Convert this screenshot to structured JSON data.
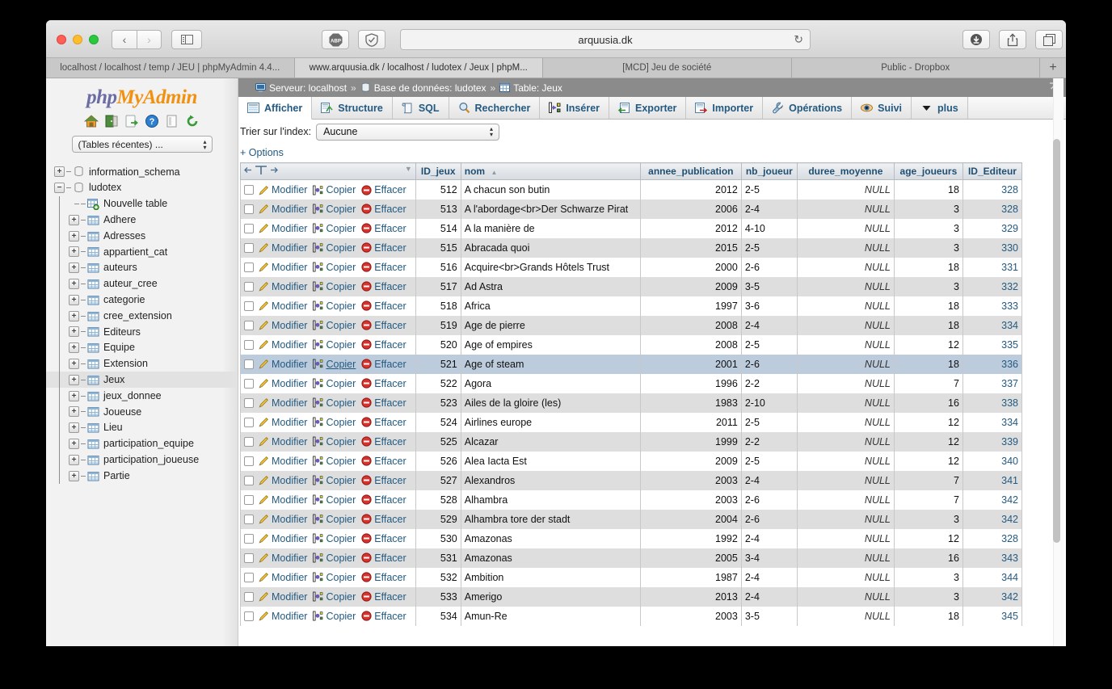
{
  "browser": {
    "url": "arquusia.dk",
    "toolbar": {
      "back_label": "‹",
      "forward_label": "›",
      "sidebar_label": "▤",
      "abp_label": "ABP",
      "shield_label": "✓",
      "reload_label": "↻",
      "download_label": "⬇",
      "share_label": "⬆",
      "tabs_label": "❐"
    },
    "tabs": [
      {
        "title": "localhost / localhost / temp / JEU | phpMyAdmin 4.4...",
        "active": false
      },
      {
        "title": "www.arquusia.dk / localhost / ludotex / Jeux | phpM...",
        "active": true
      },
      {
        "title": "[MCD] Jeu de société",
        "active": false
      },
      {
        "title": "Public - Dropbox",
        "active": false
      }
    ],
    "new_tab_label": "+"
  },
  "pma": {
    "logo": {
      "php": "php",
      "my": "My",
      "admin": "Admin"
    },
    "nav_icons": [
      "home-icon",
      "exit-icon",
      "sql-query-icon",
      "help-icon",
      "docs-icon",
      "reload-nav-icon"
    ],
    "recent_tables_label": "(Tables récentes) ...",
    "tree": [
      {
        "label": "information_schema",
        "level": 1,
        "expander": "+",
        "icon": "database-icon",
        "selected": false
      },
      {
        "label": "ludotex",
        "level": 1,
        "expander": "−",
        "icon": "database-icon",
        "selected": false
      },
      {
        "label": "Nouvelle table",
        "level": 2,
        "expander": "",
        "icon": "new-table-icon",
        "selected": false
      },
      {
        "label": "Adhere",
        "level": 2,
        "expander": "+",
        "icon": "table-icon",
        "selected": false
      },
      {
        "label": "Adresses",
        "level": 2,
        "expander": "+",
        "icon": "table-icon",
        "selected": false
      },
      {
        "label": "appartient_cat",
        "level": 2,
        "expander": "+",
        "icon": "table-icon",
        "selected": false
      },
      {
        "label": "auteurs",
        "level": 2,
        "expander": "+",
        "icon": "table-icon",
        "selected": false
      },
      {
        "label": "auteur_cree",
        "level": 2,
        "expander": "+",
        "icon": "table-icon",
        "selected": false
      },
      {
        "label": "categorie",
        "level": 2,
        "expander": "+",
        "icon": "table-icon",
        "selected": false
      },
      {
        "label": "cree_extension",
        "level": 2,
        "expander": "+",
        "icon": "table-icon",
        "selected": false
      },
      {
        "label": "Editeurs",
        "level": 2,
        "expander": "+",
        "icon": "table-icon",
        "selected": false
      },
      {
        "label": "Equipe",
        "level": 2,
        "expander": "+",
        "icon": "table-icon",
        "selected": false
      },
      {
        "label": "Extension",
        "level": 2,
        "expander": "+",
        "icon": "table-icon",
        "selected": false
      },
      {
        "label": "Jeux",
        "level": 2,
        "expander": "+",
        "icon": "table-icon",
        "selected": true
      },
      {
        "label": "jeux_donnee",
        "level": 2,
        "expander": "+",
        "icon": "table-icon",
        "selected": false
      },
      {
        "label": "Joueuse",
        "level": 2,
        "expander": "+",
        "icon": "table-icon",
        "selected": false
      },
      {
        "label": "Lieu",
        "level": 2,
        "expander": "+",
        "icon": "table-icon",
        "selected": false
      },
      {
        "label": "participation_equipe",
        "level": 2,
        "expander": "+",
        "icon": "table-icon",
        "selected": false
      },
      {
        "label": "participation_joueuse",
        "level": 2,
        "expander": "+",
        "icon": "table-icon",
        "selected": false
      },
      {
        "label": "Partie",
        "level": 2,
        "expander": "+",
        "icon": "table-icon",
        "selected": false
      }
    ],
    "breadcrumb": {
      "server_label": "Serveur: localhost",
      "database_label": "Base de données: ludotex",
      "table_label": "Table: Jeux",
      "separator": "»",
      "collapse_label": "⤒"
    },
    "tabs": [
      {
        "label": "Afficher",
        "icon": "browse-icon",
        "active": true
      },
      {
        "label": "Structure",
        "icon": "structure-icon",
        "active": false
      },
      {
        "label": "SQL",
        "icon": "sql-icon",
        "active": false
      },
      {
        "label": "Rechercher",
        "icon": "search-icon",
        "active": false
      },
      {
        "label": "Insérer",
        "icon": "insert-icon",
        "active": false
      },
      {
        "label": "Exporter",
        "icon": "export-icon",
        "active": false
      },
      {
        "label": "Importer",
        "icon": "import-icon",
        "active": false
      },
      {
        "label": "Opérations",
        "icon": "operations-icon",
        "active": false
      },
      {
        "label": "Suivi",
        "icon": "tracking-icon",
        "active": false
      },
      {
        "label": "plus",
        "icon": "chevron-down-icon",
        "active": false
      }
    ],
    "sort_index": {
      "label": "Trier sur l'index:",
      "value": "Aucune"
    },
    "options_link": "+ Options",
    "row_actions": {
      "edit": "Modifier",
      "copy": "Copier",
      "delete": "Effacer"
    },
    "table": {
      "move_header": "←T→",
      "columns": [
        "ID_jeux",
        "nom",
        "annee_publication",
        "nb_joueur",
        "duree_moyenne",
        "age_joueurs",
        "ID_Editeur"
      ],
      "sorted_column": "nom",
      "sort_direction": "asc",
      "rows": [
        {
          "id": "512",
          "nom": "A chacun son butin",
          "annee": "2012",
          "nb": "2-5",
          "duree": "NULL",
          "age": "18",
          "editeur": "328",
          "highlight": false
        },
        {
          "id": "513",
          "nom": "A l'abordage<br>Der Schwarze Pirat",
          "annee": "2006",
          "nb": "2-4",
          "duree": "NULL",
          "age": "3",
          "editeur": "328",
          "highlight": false
        },
        {
          "id": "514",
          "nom": "A la manière de",
          "annee": "2012",
          "nb": "4-10",
          "duree": "NULL",
          "age": "3",
          "editeur": "329",
          "highlight": false
        },
        {
          "id": "515",
          "nom": "Abracada quoi",
          "annee": "2015",
          "nb": "2-5",
          "duree": "NULL",
          "age": "3",
          "editeur": "330",
          "highlight": false
        },
        {
          "id": "516",
          "nom": "Acquire<br>Grands Hôtels Trust",
          "annee": "2000",
          "nb": "2-6",
          "duree": "NULL",
          "age": "18",
          "editeur": "331",
          "highlight": false
        },
        {
          "id": "517",
          "nom": "Ad Astra",
          "annee": "2009",
          "nb": "3-5",
          "duree": "NULL",
          "age": "3",
          "editeur": "332",
          "highlight": false
        },
        {
          "id": "518",
          "nom": "Africa",
          "annee": "1997",
          "nb": "3-6",
          "duree": "NULL",
          "age": "18",
          "editeur": "333",
          "highlight": false
        },
        {
          "id": "519",
          "nom": "Age de pierre",
          "annee": "2008",
          "nb": "2-4",
          "duree": "NULL",
          "age": "18",
          "editeur": "334",
          "highlight": false
        },
        {
          "id": "520",
          "nom": "Age of empires",
          "annee": "2008",
          "nb": "2-5",
          "duree": "NULL",
          "age": "12",
          "editeur": "335",
          "highlight": false
        },
        {
          "id": "521",
          "nom": "Age of steam",
          "annee": "2001",
          "nb": "2-6",
          "duree": "NULL",
          "age": "18",
          "editeur": "336",
          "highlight": true
        },
        {
          "id": "522",
          "nom": "Agora",
          "annee": "1996",
          "nb": "2-2",
          "duree": "NULL",
          "age": "7",
          "editeur": "337",
          "highlight": false
        },
        {
          "id": "523",
          "nom": "Ailes de la gloire (les)",
          "annee": "1983",
          "nb": "2-10",
          "duree": "NULL",
          "age": "16",
          "editeur": "338",
          "highlight": false
        },
        {
          "id": "524",
          "nom": "Airlines europe",
          "annee": "2011",
          "nb": "2-5",
          "duree": "NULL",
          "age": "12",
          "editeur": "334",
          "highlight": false
        },
        {
          "id": "525",
          "nom": "Alcazar",
          "annee": "1999",
          "nb": "2-2",
          "duree": "NULL",
          "age": "12",
          "editeur": "339",
          "highlight": false
        },
        {
          "id": "526",
          "nom": "Alea Iacta Est",
          "annee": "2009",
          "nb": "2-5",
          "duree": "NULL",
          "age": "12",
          "editeur": "340",
          "highlight": false
        },
        {
          "id": "527",
          "nom": "Alexandros",
          "annee": "2003",
          "nb": "2-4",
          "duree": "NULL",
          "age": "7",
          "editeur": "341",
          "highlight": false
        },
        {
          "id": "528",
          "nom": "Alhambra",
          "annee": "2003",
          "nb": "2-6",
          "duree": "NULL",
          "age": "7",
          "editeur": "342",
          "highlight": false
        },
        {
          "id": "529",
          "nom": "Alhambra tore der stadt",
          "annee": "2004",
          "nb": "2-6",
          "duree": "NULL",
          "age": "3",
          "editeur": "342",
          "highlight": false
        },
        {
          "id": "530",
          "nom": "Amazonas",
          "annee": "1992",
          "nb": "2-4",
          "duree": "NULL",
          "age": "12",
          "editeur": "328",
          "highlight": false
        },
        {
          "id": "531",
          "nom": "Amazonas",
          "annee": "2005",
          "nb": "3-4",
          "duree": "NULL",
          "age": "16",
          "editeur": "343",
          "highlight": false
        },
        {
          "id": "532",
          "nom": "Ambition",
          "annee": "1987",
          "nb": "2-4",
          "duree": "NULL",
          "age": "3",
          "editeur": "344",
          "highlight": false
        },
        {
          "id": "533",
          "nom": "Amerigo",
          "annee": "2013",
          "nb": "2-4",
          "duree": "NULL",
          "age": "3",
          "editeur": "342",
          "highlight": false
        },
        {
          "id": "534",
          "nom": "Amun-Re",
          "annee": "2003",
          "nb": "3-5",
          "duree": "NULL",
          "age": "18",
          "editeur": "345",
          "highlight": false
        }
      ]
    }
  },
  "colors": {
    "link": "#235a81",
    "header_bg": "#d7dce1",
    "breadcrumb_bg": "#8b8b8b",
    "row_even": "#dedede",
    "row_highlight": "#bcccdd",
    "logo_orange": "#f29111",
    "logo_purple": "#6c6ca5"
  }
}
